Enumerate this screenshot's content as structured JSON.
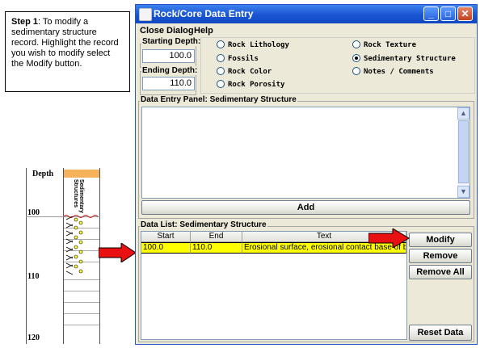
{
  "callout": {
    "step": "Step 1",
    "text": ": To modify a sedimentary structure record.  Highlight the record you wish to modify select the Modify button."
  },
  "strip_log": {
    "header_depth": "Depth",
    "header_column": "Sedimentary Structures",
    "depth_labels": [
      "100",
      "110",
      "120"
    ]
  },
  "window": {
    "title": "Rock/Core Data Entry",
    "controls": {
      "minimize": "_",
      "maximize": "□",
      "close": "✕"
    },
    "menu": [
      "Close Dialog",
      "Help"
    ],
    "starting_depth": {
      "label": "Starting Depth:",
      "value": "100.0"
    },
    "ending_depth": {
      "label": "Ending Depth:",
      "value": "110.0"
    },
    "options": [
      {
        "label": "Rock Lithology",
        "selected": false
      },
      {
        "label": "Fossils",
        "selected": false
      },
      {
        "label": "Rock Color",
        "selected": false
      },
      {
        "label": "Rock Porosity",
        "selected": false
      },
      {
        "label": "Rock Texture",
        "selected": false
      },
      {
        "label": "Sedimentary Structure",
        "selected": true
      },
      {
        "label": "Notes / Comments",
        "selected": false
      }
    ],
    "entry_panel": {
      "label": "Data Entry Panel: Sedimentary Structure",
      "add_button": "Add"
    },
    "data_list": {
      "label": "Data List: Sedimentary Structure",
      "columns": [
        "Start",
        "End",
        "Text"
      ],
      "rows": [
        {
          "start": "100.0",
          "end": "110.0",
          "text": "Erosional surface, erosional contact base of b..."
        }
      ]
    },
    "buttons": {
      "modify": "Modify",
      "remove": "Remove",
      "remove_all": "Remove All",
      "reset": "Reset Data"
    }
  },
  "colors": {
    "highlight": "#ffff00",
    "arrow": "#e81010",
    "titlebar": "#1a55d2",
    "window_bg": "#ece9d8",
    "strip_header": "#f6b25a"
  }
}
